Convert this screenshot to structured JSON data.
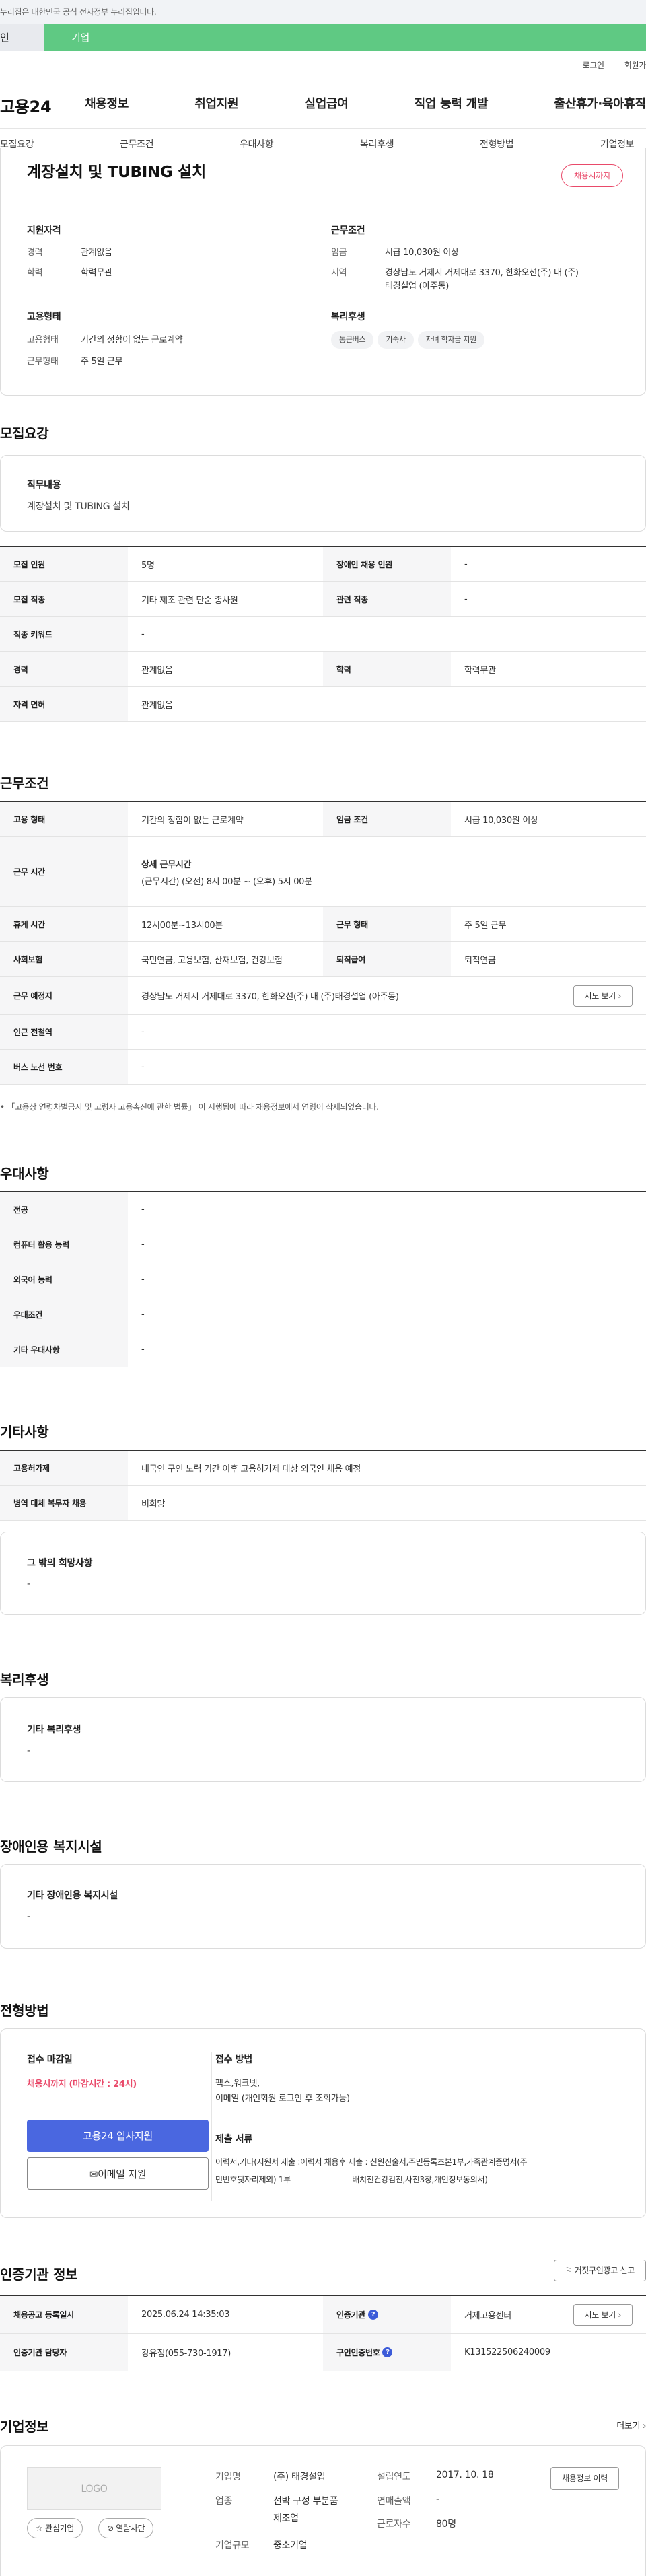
{
  "gov_banner": "누리집은 대한민국 공식 전자정부 누리집입니다.",
  "user_tabs": {
    "personal": "인",
    "corporate": "기업"
  },
  "util": {
    "login": "로그인",
    "join": "회원가"
  },
  "logo": "고용24",
  "gnb": [
    "채용정보",
    "취업지원",
    "실업급여",
    "직업 능력 개발",
    "출산휴가·육아휴직"
  ],
  "snb": [
    "모집요강",
    "근무조건",
    "우대사항",
    "복리후생",
    "전형방법",
    "기업정보"
  ],
  "job": {
    "title": "계장설치 및 TUBING 설치",
    "status": "채용시까지"
  },
  "summary": {
    "qual_title": "지원자격",
    "career_k": "경력",
    "career_v": "관계없음",
    "edu_k": "학력",
    "edu_v": "학력무관",
    "cond_title": "근무조건",
    "wage_k": "임금",
    "wage_v": "시급 10,030원 이상",
    "loc_k": "지역",
    "loc_v1": "경상남도 거제시 거제대로 3370, 한화오션(주) 내 (주)",
    "loc_v2": "태경설업 (아주동)",
    "emp_title": "고용형태",
    "emptype_k": "고용형태",
    "emptype_v": "기간의 정함이 없는 근로계약",
    "workform_k": "근무형태",
    "workform_v": "주 5일 근무",
    "welfare_title": "복리후생",
    "chips": [
      "통근버스",
      "기숙사",
      "자녀 학자금 지원"
    ]
  },
  "recruit": {
    "section": "모집요강",
    "duty_title": "직무내용",
    "duty_value": "계장설치 및 TUBING 설치",
    "rows": [
      {
        "k1": "모집 인원",
        "v1": "5명",
        "k2": "장애인 채용 인원",
        "v2": "-"
      },
      {
        "k1": "모집 직종",
        "v1": "기타 제조 관련 단순 종사원",
        "k2": "관련 직종",
        "v2": "-"
      },
      {
        "k1": "직종 키워드",
        "v1": "-"
      },
      {
        "k1": "경력",
        "v1": "관계없음",
        "k2": "학력",
        "v2": "학력무관"
      },
      {
        "k1": "자격 면허",
        "v1": "관계없음"
      }
    ]
  },
  "work": {
    "section": "근무조건",
    "emp_k": "고용 형태",
    "emp_v": "기간의 정함이 없는 근로계약",
    "wage_k": "임금 조건",
    "wage_v": "시급 10,030원 이상",
    "time_k": "근무 시간",
    "time_head": "상세 근무시간",
    "time_v": "(근무시간) (오전) 8시 00분 ~ (오후) 5시 00분",
    "rest_k": "휴게 시간",
    "rest_v": "12시00분~13시00분",
    "form_k": "근무 형태",
    "form_v": "주 5일 근무",
    "ins_k": "사회보험",
    "ins_v": "국민연금, 고용보험, 산재보험, 건강보험",
    "sev_k": "퇴직급여",
    "sev_v": "퇴직연금",
    "place_k": "근무 예정지",
    "place_v": "경상남도 거제시 거제대로 3370, 한화오션(주) 내 (주)태경설업 (아주동)",
    "map_btn": "지도 보기",
    "subway_k": "인근 전철역",
    "subway_v": "-",
    "bus_k": "버스 노선 번호",
    "bus_v": "-",
    "note": "「고용상 연령차별금지 및 고령자 고용촉진에 관한 법률」 이 시행됨에 따라 채용정보에서 연령이 삭제되었습니다."
  },
  "pref": {
    "section": "우대사항",
    "rows": [
      {
        "k": "전공",
        "v": "-"
      },
      {
        "k": "컴퓨터 활용 능력",
        "v": "-"
      },
      {
        "k": "외국어 능력",
        "v": "-"
      },
      {
        "k": "우대조건",
        "v": "-"
      },
      {
        "k": "기타 우대사항",
        "v": "-"
      }
    ]
  },
  "etc": {
    "section": "기타사항",
    "rows": [
      {
        "k": "고용허가제",
        "v": "내국인 구인 노력 기간 이후 고용허가제 대상 외국인 채용 예정"
      },
      {
        "k": "병역 대체 복무자 채용",
        "v": "비희망"
      }
    ],
    "box_title": "그 밖의 희망사항",
    "box_value": "-"
  },
  "welfare": {
    "section": "복리후생",
    "box_title": "기타 복리후생",
    "box_value": "-"
  },
  "disabled": {
    "section": "장애인용 복지시설",
    "box_title": "기타 장애인용 복지시설",
    "box_value": "-"
  },
  "screening": {
    "section": "전형방법",
    "deadline_title": "접수 마감일",
    "deadline_value": "채용시까지 (마감시간 : 24시)",
    "apply_btn": "고용24 입사지원",
    "email_btn": "이메일 지원",
    "method_title": "접수 방법",
    "method_l1": "팩스,워크넷,",
    "method_l2": "이메일 (개인회원 로그인 후 조회가능)",
    "docs_title": "제출 서류",
    "docs_l1": "이력서,기타(지원서 제출 :이력서 채용후 제출 : 신원진술서,주민등록초본1부,가족관계증명서(주",
    "docs_l2": "민번호뒷자리제외) 1부                          배치전건강검진,사진3장,개인정보동의서)"
  },
  "cert": {
    "section": "인증기관 정보",
    "report_btn": "거짓구인광고 신고",
    "reg_k": "채용공고 등록일시",
    "reg_v": "2025.06.24 14:35:03",
    "inst_k": "인증기관",
    "inst_v": "거제고용센터",
    "map_btn": "지도 보기",
    "mgr_k": "인증기관 담당자",
    "mgr_v": "강유정(055-730-1917)",
    "no_k": "구인인증번호",
    "no_v": "K131522506240009"
  },
  "company": {
    "section": "기업정보",
    "more": "더보기",
    "logo_text": "LOGO",
    "fav_btn": "관심기업",
    "block_btn": "열람차단",
    "name_k": "기업명",
    "name_v": "(주) 태경설업",
    "biz_k": "업종",
    "biz_v1": "선박 구성 부분품",
    "biz_v2": "제조업",
    "size_k": "기업규모",
    "size_v": "중소기업",
    "year_k": "설립연도",
    "year_v": "2017. 10. 18",
    "sales_k": "연매출액",
    "sales_v": "-",
    "emp_k": "근로자수",
    "emp_v": "80명",
    "history_btn": "채용정보 이력"
  },
  "colors": {
    "accent": "#5fc983",
    "primary": "#4a67e0",
    "danger": "#e94a6a"
  }
}
